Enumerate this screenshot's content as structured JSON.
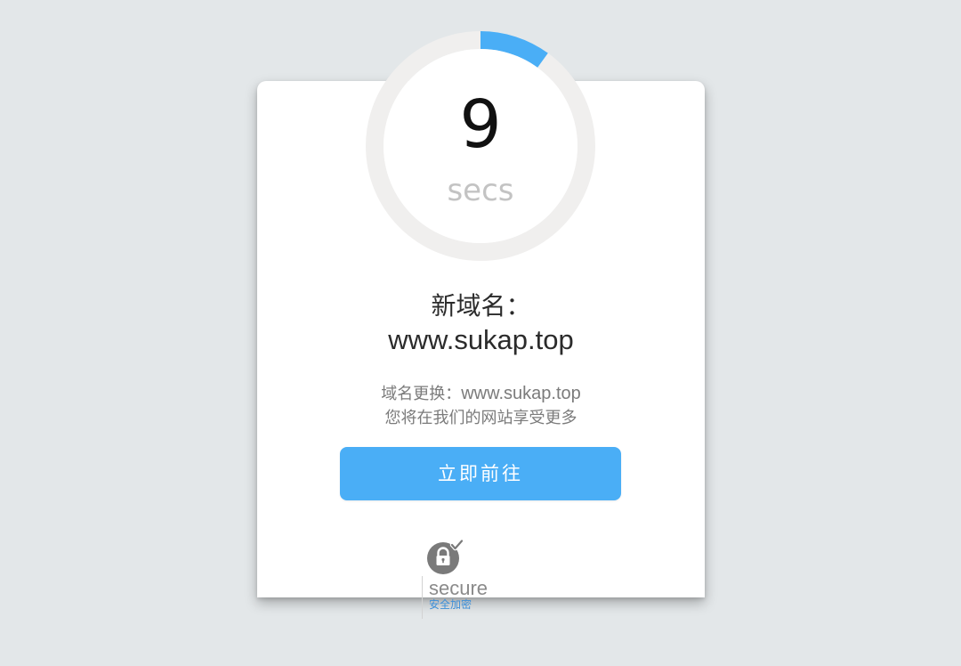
{
  "countdown": {
    "value": "9",
    "unit": "secs",
    "progress_fraction": 0.1
  },
  "content": {
    "title": "新域名：",
    "domain": "www.sukap.top",
    "desc_prefix": "域名更换：",
    "desc_url": "www.sukap.top",
    "desc_line2": "您将在我们的网站享受更多"
  },
  "button": {
    "label": "立即前往"
  },
  "secure": {
    "label": "secure",
    "sub_label": "安全加密",
    "icon": "lock-check-icon"
  },
  "colors": {
    "accent": "#4aaef6",
    "ring_track": "#f0efee",
    "background": "#e3e7e9"
  }
}
